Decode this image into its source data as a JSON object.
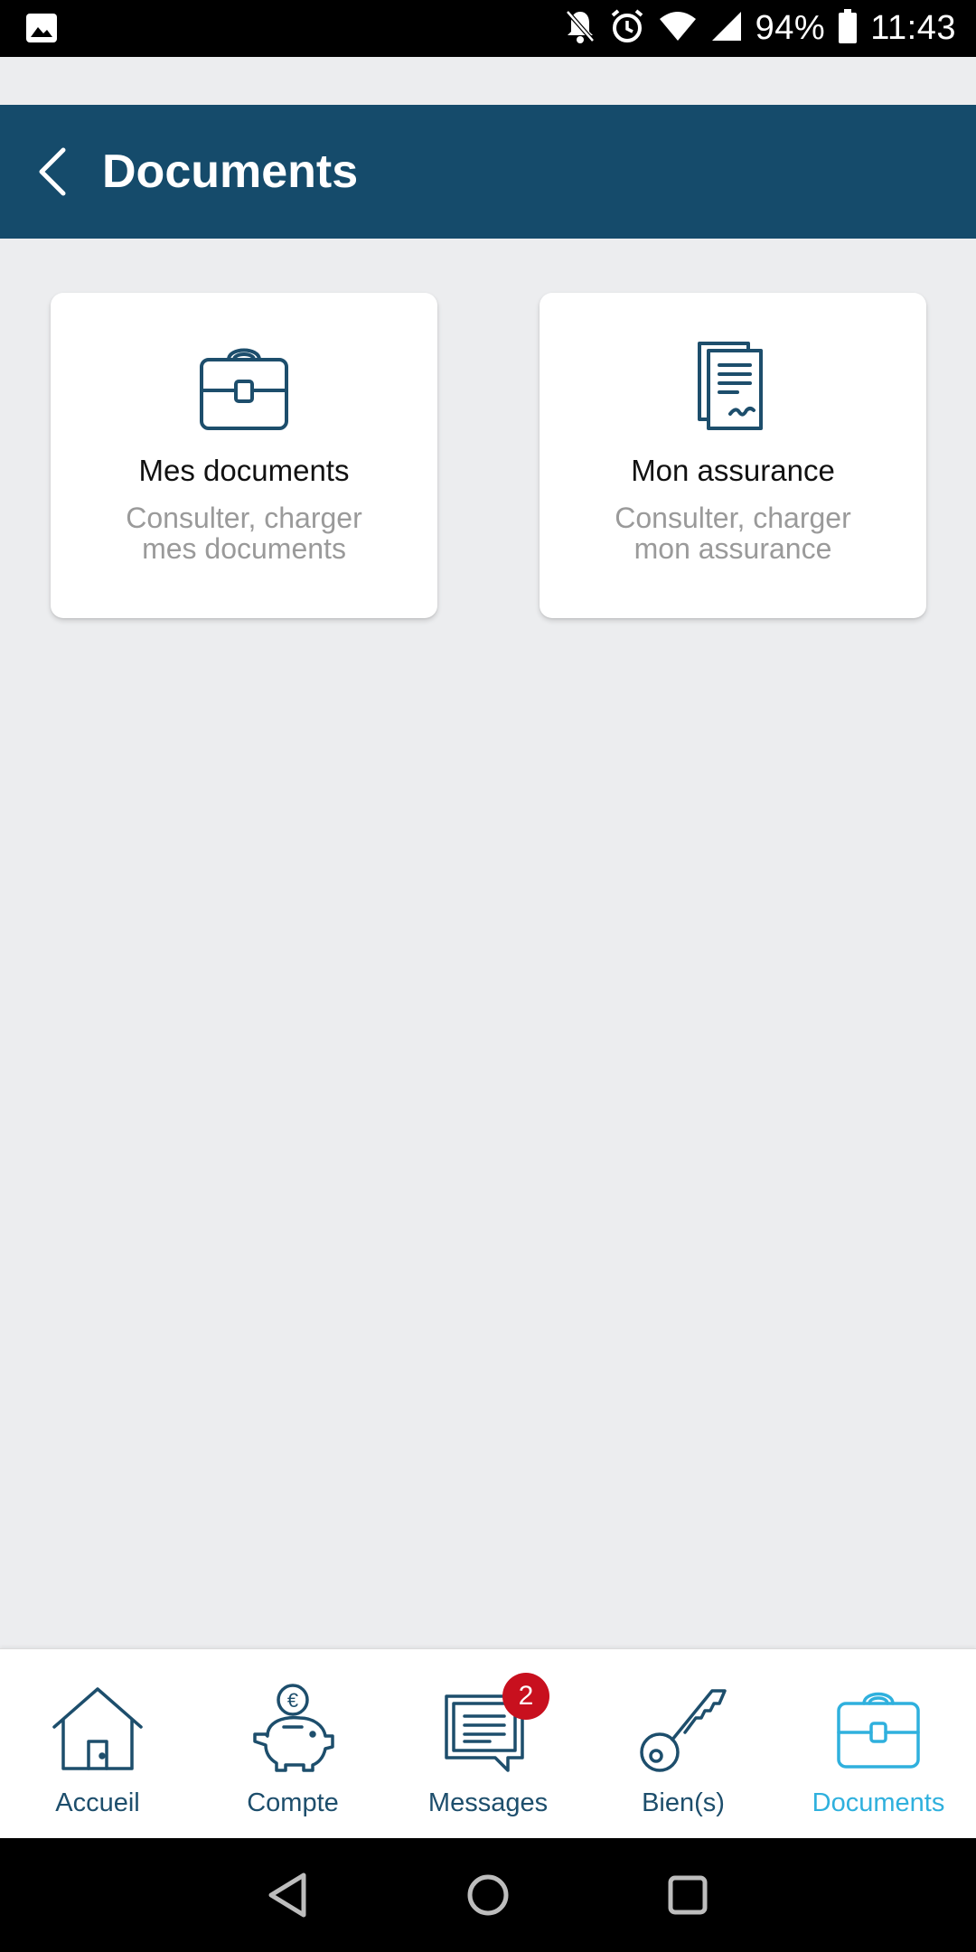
{
  "status_bar": {
    "battery": "94%",
    "time": "11:43"
  },
  "header": {
    "title": "Documents"
  },
  "cards": [
    {
      "title": "Mes documents",
      "desc_line1": "Consulter, charger",
      "desc_line2": "mes documents",
      "icon": "briefcase-icon"
    },
    {
      "title": "Mon assurance",
      "desc_line1": "Consulter, charger",
      "desc_line2": "mon assurance",
      "icon": "document-stack-icon"
    }
  ],
  "bottom_nav": {
    "items": [
      {
        "label": "Accueil",
        "icon": "house-icon"
      },
      {
        "label": "Compte",
        "icon": "piggy-bank-icon"
      },
      {
        "label": "Messages",
        "icon": "message-icon"
      },
      {
        "label": "Bien(s)",
        "icon": "key-icon"
      },
      {
        "label": "Documents",
        "icon": "briefcase-icon"
      }
    ],
    "messages_badge": "2",
    "active": "Documents"
  },
  "colors": {
    "primary": "#154b6b",
    "active": "#2fb0dd",
    "badge": "#c8101e",
    "background": "#ecedef"
  }
}
